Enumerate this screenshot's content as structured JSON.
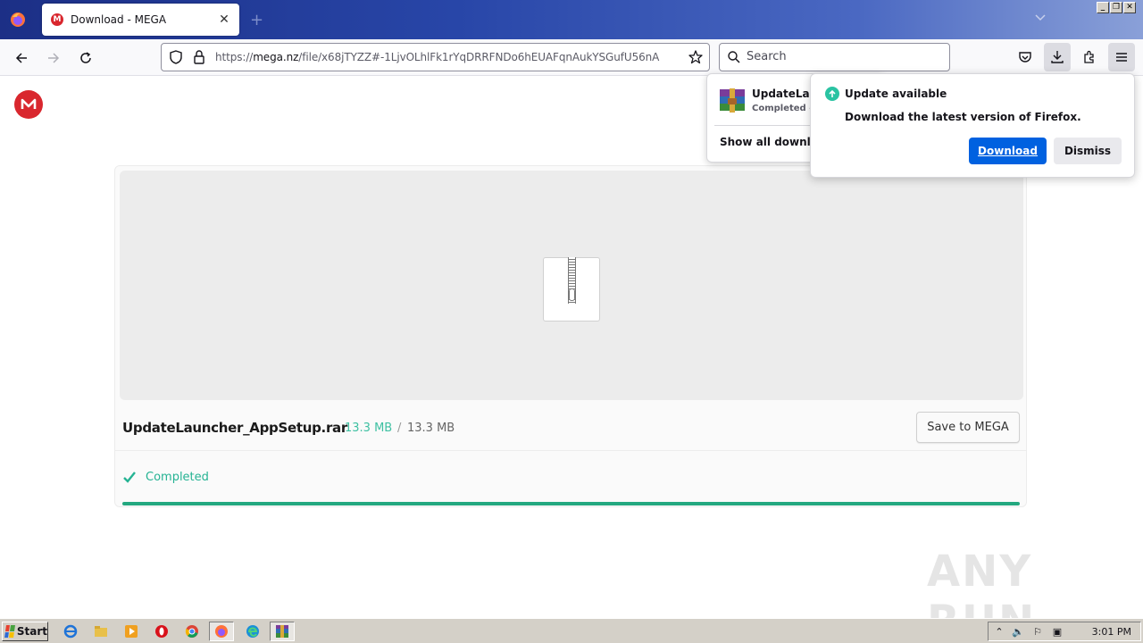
{
  "browser": {
    "tab": {
      "title": "Download - MEGA",
      "favicon_letter": "M"
    },
    "url": {
      "prefix": "https://",
      "domain": "mega.nz",
      "path": "/file/x68jTYZZ#-1LjvOLhlFk1rYqDRRFNDo6hEUAFqnAukYSGufU56nA"
    },
    "search": {
      "placeholder": "Search"
    }
  },
  "page": {
    "file": {
      "name": "UpdateLauncher_AppSetup.rar",
      "downloaded": "13.3 MB",
      "separator": "/",
      "total": "13.3 MB",
      "save_label": "Save to MEGA",
      "status": "Completed",
      "progress": 100
    }
  },
  "downloads_panel": {
    "item_name": "UpdateLaun",
    "item_status": "Completed —",
    "show_all": "Show all downloads"
  },
  "update_panel": {
    "title": "Update available",
    "description": "Download the latest version of Firefox.",
    "download_label": "Download",
    "dismiss_label": "Dismiss"
  },
  "watermark": "ANY RUN",
  "taskbar": {
    "start_label": "Start",
    "clock": "3:01 PM"
  },
  "colors": {
    "mega_red": "#d9272e",
    "progress": "#24a880",
    "firefox_blue": "#0061e0"
  }
}
